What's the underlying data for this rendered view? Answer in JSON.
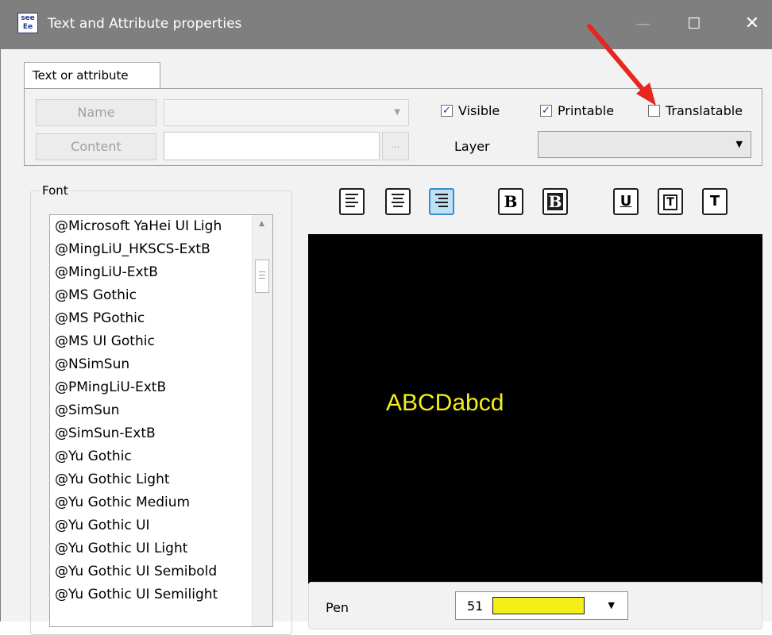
{
  "window": {
    "title": "Text and Attribute properties",
    "icon_text": "see Ee",
    "icon": "app-icon",
    "minimize_icon": "minimize-icon",
    "maximize_icon": "maximize-icon",
    "close_icon": "close-icon"
  },
  "tab": {
    "label": "Text or attribute"
  },
  "attribute": {
    "name_button": "Name",
    "content_button": "Content",
    "browse_button": "...",
    "visible_label": "Visible",
    "visible_checked": true,
    "printable_label": "Printable",
    "printable_checked": true,
    "translatable_label": "Translatable",
    "translatable_checked": false,
    "layer_label": "Layer",
    "check_glyph": "✓"
  },
  "font": {
    "group_label": "Font",
    "items": [
      "@Microsoft YaHei UI Ligh",
      "@MingLiU_HKSCS-ExtB",
      "@MingLiU-ExtB",
      "@MS Gothic",
      "@MS PGothic",
      "@MS UI Gothic",
      "@NSimSun",
      "@PMingLiU-ExtB",
      "@SimSun",
      "@SimSun-ExtB",
      "@Yu Gothic",
      "@Yu Gothic Light",
      "@Yu Gothic Medium",
      "@Yu Gothic UI",
      "@Yu Gothic UI Light",
      "@Yu Gothic UI Semibold",
      "@Yu Gothic UI Semilight"
    ]
  },
  "format": {
    "bold_label": "B",
    "bold_outline_label": "B",
    "underline_label": "U",
    "frame_label": "T",
    "text_label": "T",
    "align_active": "right"
  },
  "preview": {
    "text": "ABCDabcd",
    "background": "#000000",
    "text_color": "#f4ef17"
  },
  "pen": {
    "label": "Pen",
    "value": "51",
    "color": "#f4ef17"
  },
  "annotation": {
    "arrow_color": "#e8251f"
  }
}
